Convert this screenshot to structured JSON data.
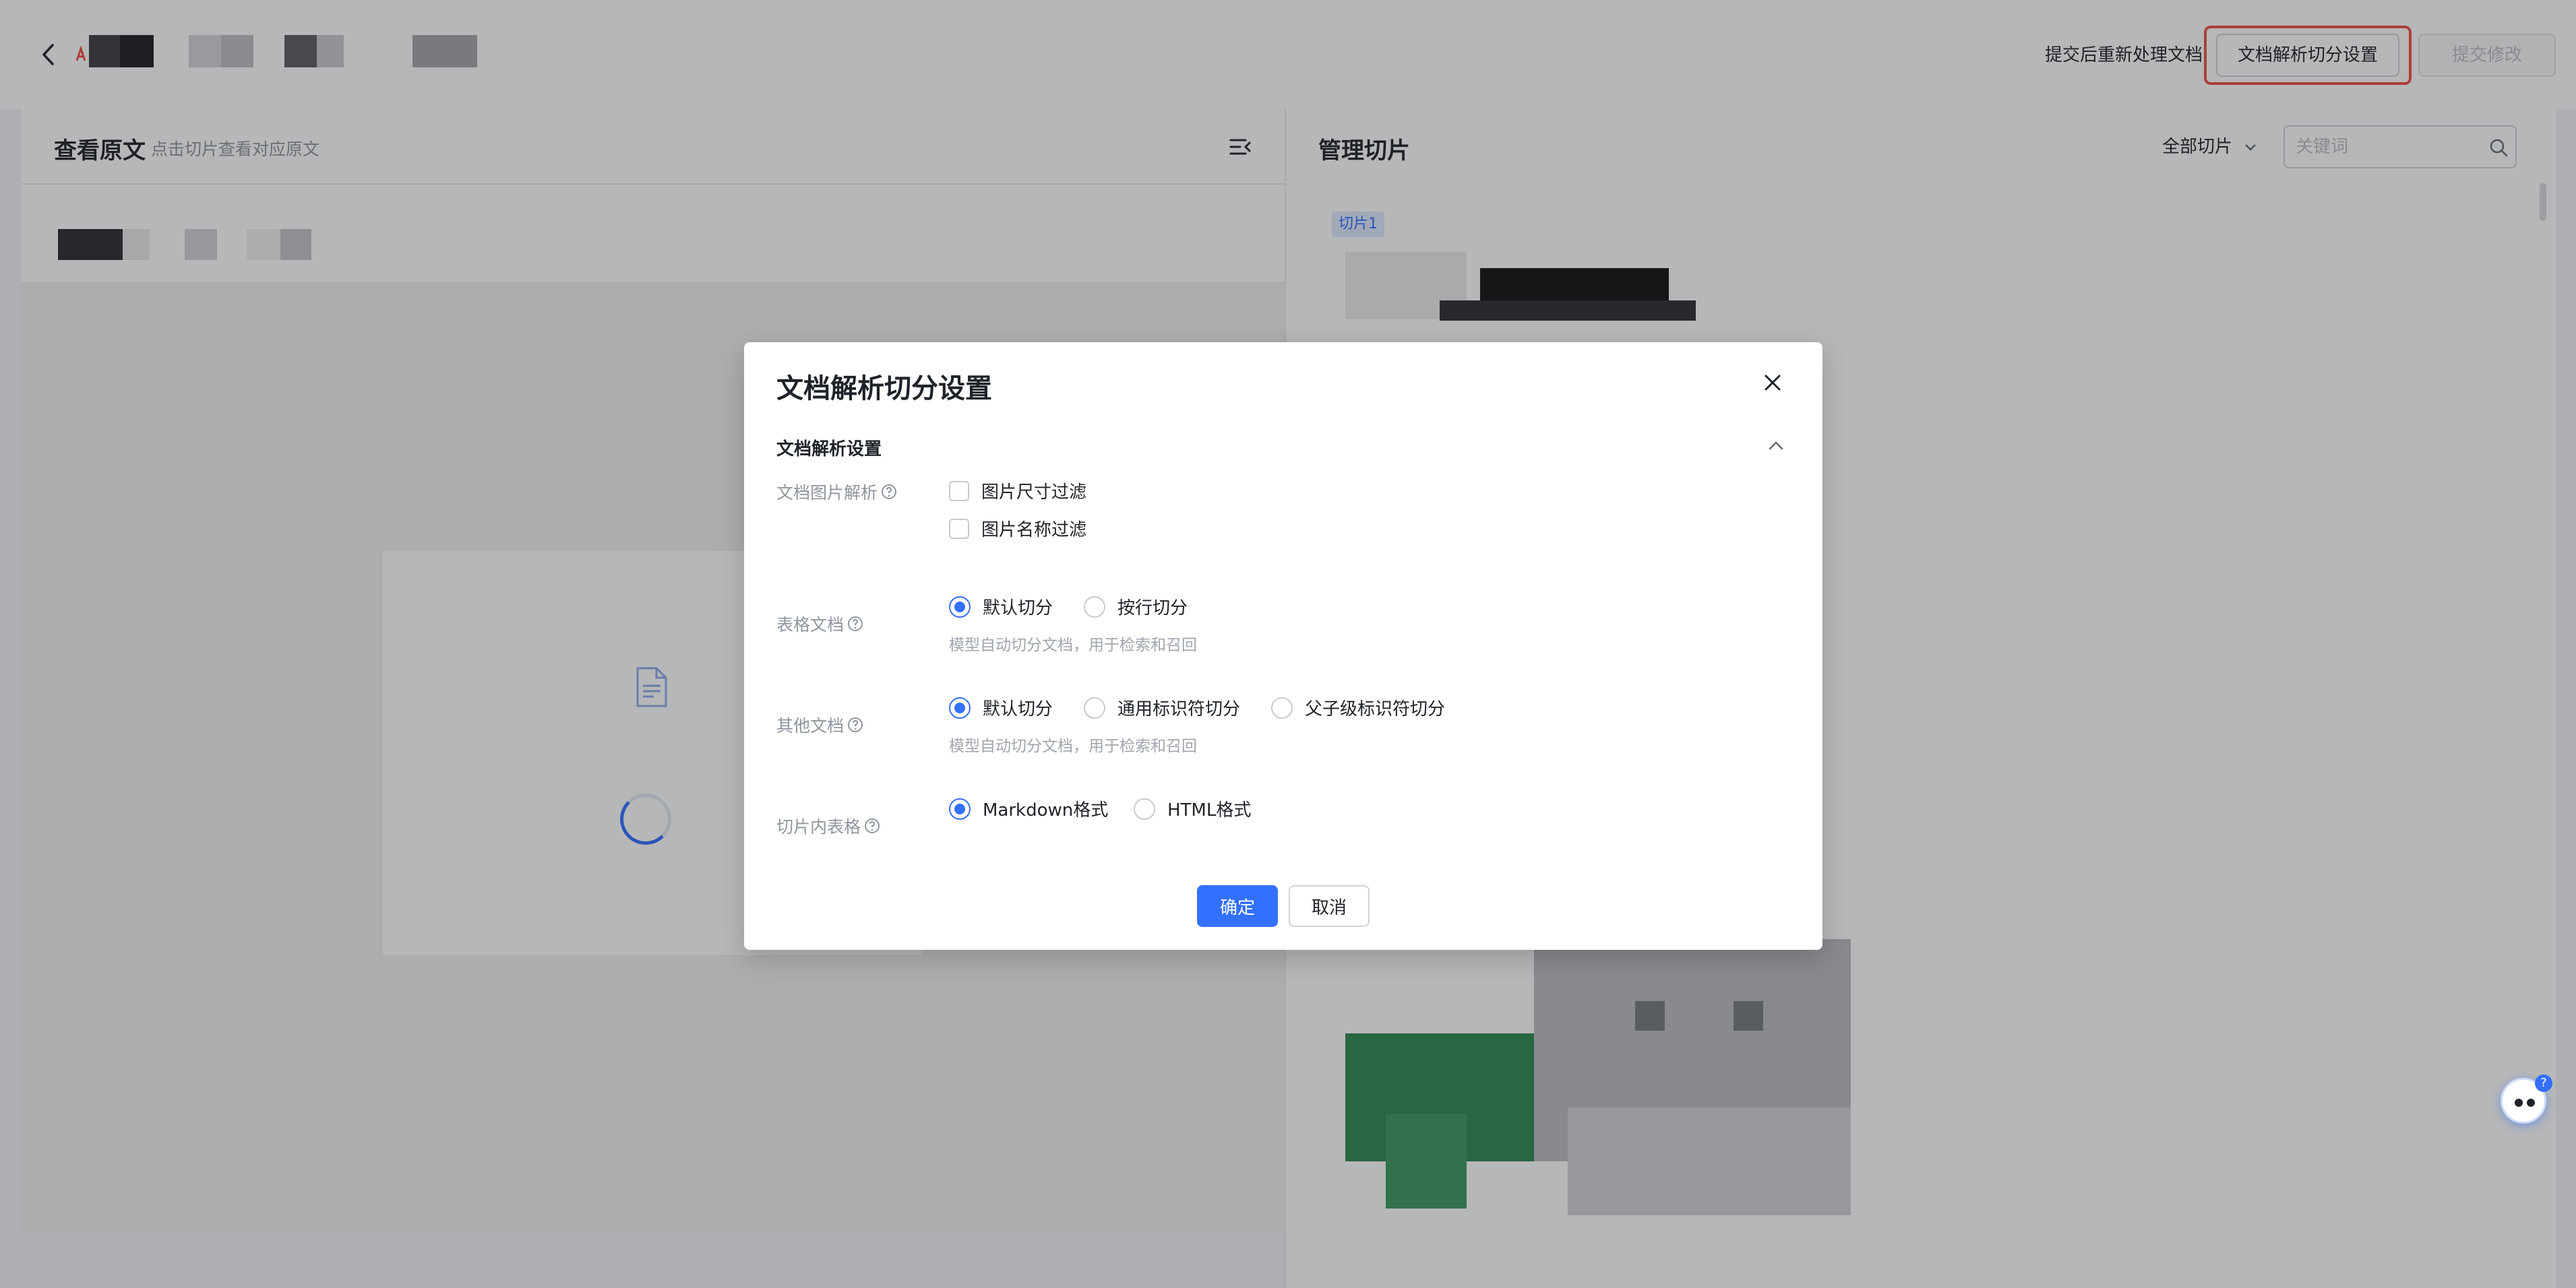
{
  "topbar": {
    "reprocess_text": "提交后重新处理文档",
    "settings_button": "文档解析切分设置",
    "submit_button": "提交修改"
  },
  "left_panel": {
    "title": "查看原文",
    "subtitle": "点击切片查看对应原文"
  },
  "right_panel": {
    "title": "管理切片",
    "filter_label": "全部切片",
    "search_placeholder": "关键词",
    "chunk_tag": "切片1"
  },
  "modal": {
    "title": "文档解析切分设置",
    "section_title": "文档解析设置",
    "image_parsing": {
      "label": "文档图片解析",
      "options": [
        {
          "label": "图片尺寸过滤",
          "checked": false
        },
        {
          "label": "图片名称过滤",
          "checked": false
        }
      ]
    },
    "table_doc": {
      "label": "表格文档",
      "options": [
        {
          "label": "默认切分",
          "selected": true
        },
        {
          "label": "按行切分",
          "selected": false
        }
      ],
      "hint": "模型自动切分文档，用于检索和召回"
    },
    "other_doc": {
      "label": "其他文档",
      "options": [
        {
          "label": "默认切分",
          "selected": true
        },
        {
          "label": "通用标识符切分",
          "selected": false
        },
        {
          "label": "父子级标识符切分",
          "selected": false
        }
      ],
      "hint": "模型自动切分文档，用于检索和召回"
    },
    "chunk_table": {
      "label": "切片内表格",
      "options": [
        {
          "label": "Markdown格式",
          "selected": true
        },
        {
          "label": "HTML格式",
          "selected": false
        }
      ]
    },
    "confirm_button": "确定",
    "cancel_button": "取消"
  },
  "assistant": {
    "badge": "?"
  },
  "colors": {
    "accent": "#3370ff",
    "highlight_border": "#ef4d46"
  }
}
